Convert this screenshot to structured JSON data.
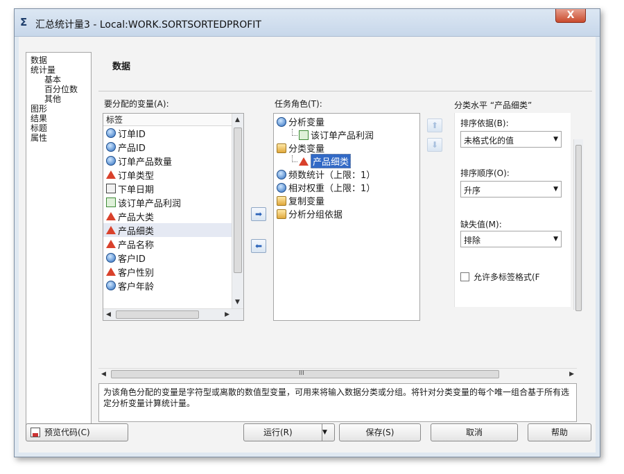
{
  "window": {
    "title": "汇总统计量3 - Local:WORK.SORTSORTEDPROFIT",
    "icon": "sigma-icon",
    "close_label": "X"
  },
  "nav": {
    "items": [
      {
        "label": "数据",
        "sub": false
      },
      {
        "label": "统计量",
        "sub": false
      },
      {
        "label": "基本",
        "sub": true
      },
      {
        "label": "百分位数",
        "sub": true
      },
      {
        "label": "其他",
        "sub": true
      },
      {
        "label": "图形",
        "sub": false
      },
      {
        "label": "结果",
        "sub": false
      },
      {
        "label": "标题",
        "sub": false
      },
      {
        "label": "属性",
        "sub": false
      }
    ]
  },
  "main": {
    "section_title": "数据",
    "variables_label": "要分配的变量(A):",
    "variables_header": "标签",
    "variables": [
      {
        "label": "订单ID",
        "icon": "numeric-icon"
      },
      {
        "label": "产品ID",
        "icon": "numeric-icon"
      },
      {
        "label": "订单产品数量",
        "icon": "numeric-icon"
      },
      {
        "label": "订单类型",
        "icon": "character-icon"
      },
      {
        "label": "下单日期",
        "icon": "date-icon"
      },
      {
        "label": "该订单产品利润",
        "icon": "currency-icon"
      },
      {
        "label": "产品大类",
        "icon": "character-icon"
      },
      {
        "label": "产品细类",
        "icon": "character-icon"
      },
      {
        "label": "产品名称",
        "icon": "character-icon"
      },
      {
        "label": "客户ID",
        "icon": "numeric-icon"
      },
      {
        "label": "客户性别",
        "icon": "character-icon"
      },
      {
        "label": "客户年龄",
        "icon": "numeric-icon"
      }
    ],
    "roles_label": "任务角色(T):",
    "roles": [
      {
        "label": "分析变量",
        "level": 0,
        "icon": "numeric-icon"
      },
      {
        "label": "该订单产品利润",
        "level": 1,
        "icon": "currency-icon"
      },
      {
        "label": "分类变量",
        "level": 0,
        "icon": "role-icon"
      },
      {
        "label": "产品细类",
        "level": 1,
        "icon": "character-icon",
        "selected": true
      },
      {
        "label": "频数统计（上限：1）",
        "level": 0,
        "icon": "numeric-icon"
      },
      {
        "label": "相对权重（上限：1）",
        "level": 0,
        "icon": "numeric-icon"
      },
      {
        "label": "复制变量",
        "level": 0,
        "icon": "role-icon"
      },
      {
        "label": "分析分组依据",
        "level": 0,
        "icon": "role-icon"
      }
    ],
    "class_panel": {
      "title": "分类水平 “产品细类”",
      "sort_by_label": "排序依据(B):",
      "sort_by_value": "未格式化的值",
      "sort_order_label": "排序顺序(O):",
      "sort_order_value": "升序",
      "missing_label": "缺失值(M):",
      "missing_value": "排除",
      "multilabel_label": "允许多标签格式(F"
    },
    "help_text": "为该角色分配的变量是字符型或离散的数值型变量，可用来将输入数据分类或分组。将针对分类变量的每个唯一组合基于所有选定分析变量计算统计量。",
    "hscroll_mark": "III"
  },
  "buttons": {
    "preview": "预览代码(C)",
    "run": "运行(R)",
    "save": "保存(S)",
    "cancel": "取消",
    "help": "帮助"
  }
}
